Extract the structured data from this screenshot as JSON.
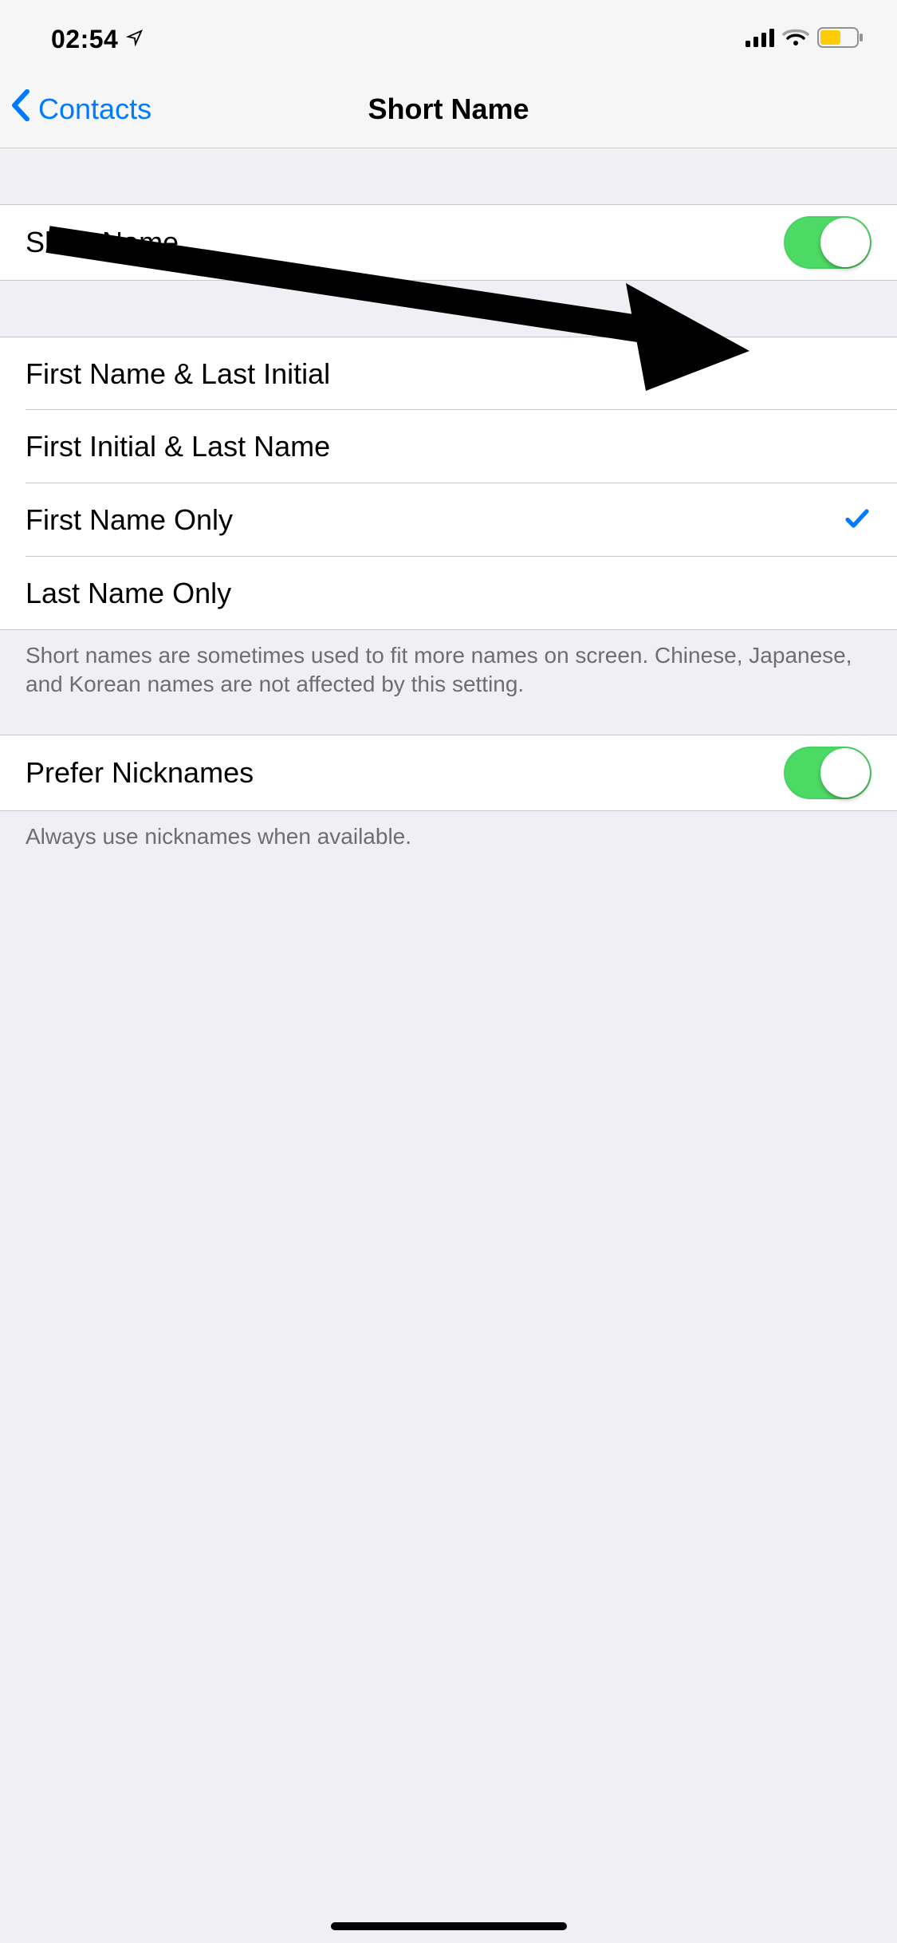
{
  "status": {
    "time": "02:54"
  },
  "nav": {
    "back_label": "Contacts",
    "title": "Short Name"
  },
  "short_name_toggle": {
    "label": "Short Name",
    "on": true
  },
  "options": [
    {
      "label": "First Name & Last Initial",
      "selected": false
    },
    {
      "label": "First Initial & Last Name",
      "selected": false
    },
    {
      "label": "First Name Only",
      "selected": true
    },
    {
      "label": "Last Name Only",
      "selected": false
    }
  ],
  "options_footer": "Short names are sometimes used to fit more names on screen. Chinese, Japanese, and Korean names are not affected by this setting.",
  "prefer_nicknames": {
    "label": "Prefer Nicknames",
    "on": true,
    "footer": "Always use nicknames when available."
  }
}
